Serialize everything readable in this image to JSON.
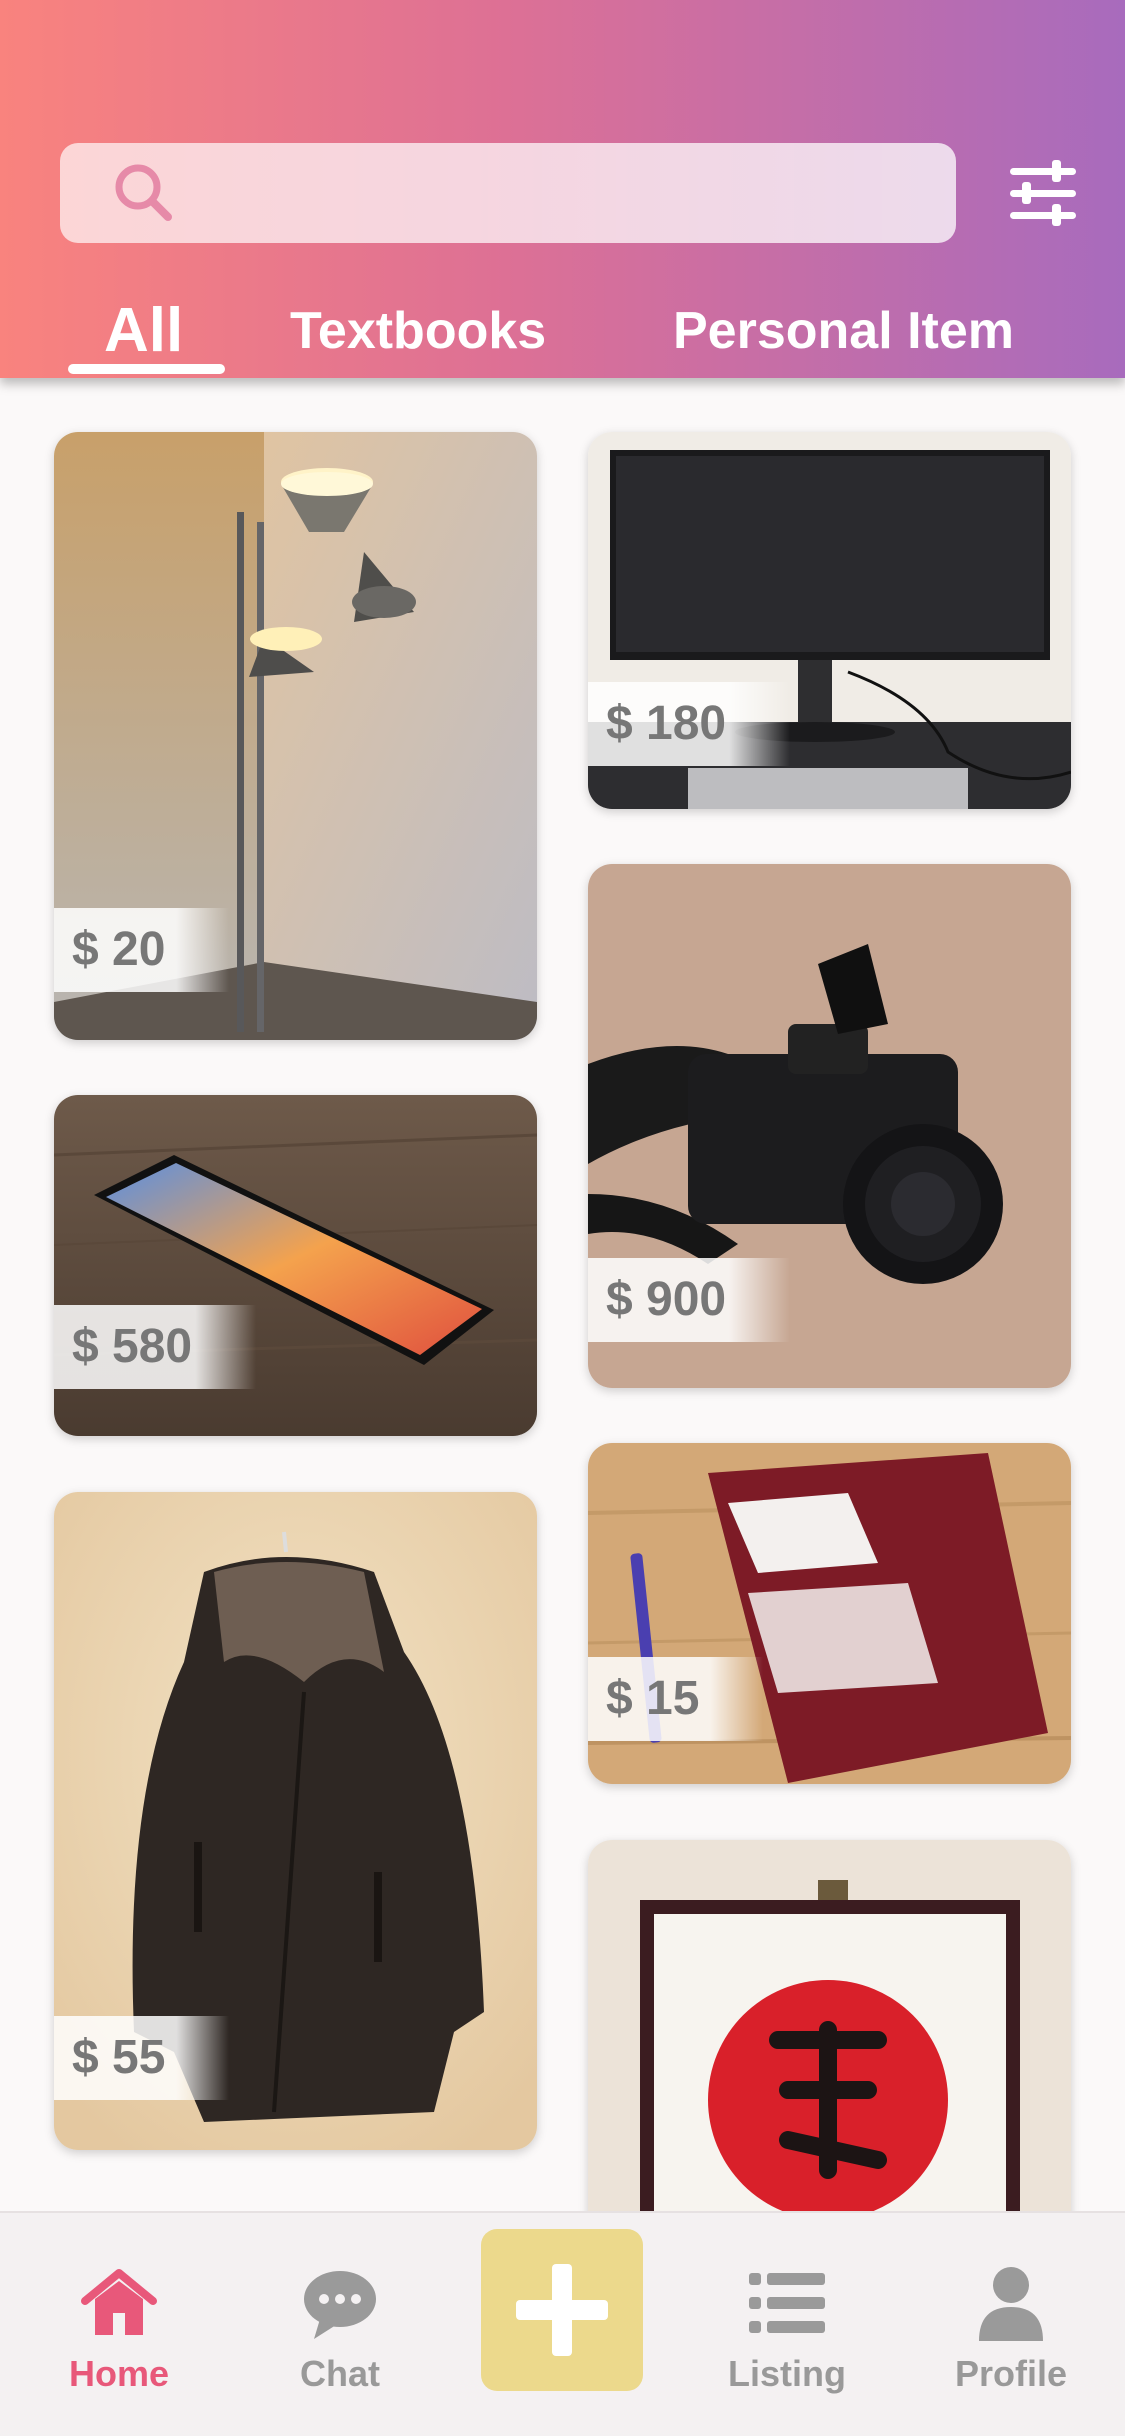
{
  "search": {
    "value": "",
    "placeholder": ""
  },
  "icons": {
    "search": "search-icon",
    "filter": "filter-sliders-icon",
    "home": "home-icon",
    "chat": "chat-bubble-icon",
    "add": "plus-icon",
    "listing": "list-icon",
    "profile": "person-icon"
  },
  "tabs": [
    {
      "label": "All",
      "active": true
    },
    {
      "label": "Textbooks",
      "active": false
    },
    {
      "label": "Personal Item",
      "active": false
    }
  ],
  "listings": [
    {
      "item": "floor lamp",
      "price": "$ 20"
    },
    {
      "item": "monitor",
      "price": "$ 180"
    },
    {
      "item": "camera",
      "price": "$ 900"
    },
    {
      "item": "smartphone",
      "price": "$ 580"
    },
    {
      "item": "book",
      "price": "$ 15"
    },
    {
      "item": "leather jacket",
      "price": "$ 55"
    },
    {
      "item": "framed calligraphy",
      "price": ""
    }
  ],
  "nav": [
    {
      "label": "Home",
      "active": true
    },
    {
      "label": "Chat",
      "active": false
    },
    {
      "label": "Listing",
      "active": false
    },
    {
      "label": "Profile",
      "active": false
    }
  ],
  "colors": {
    "header_gradient_start": "#f9837e",
    "header_gradient_end": "#a86bbd",
    "active_nav": "#e8587a",
    "inactive_nav": "#999999",
    "add_button": "#ecd98c"
  }
}
